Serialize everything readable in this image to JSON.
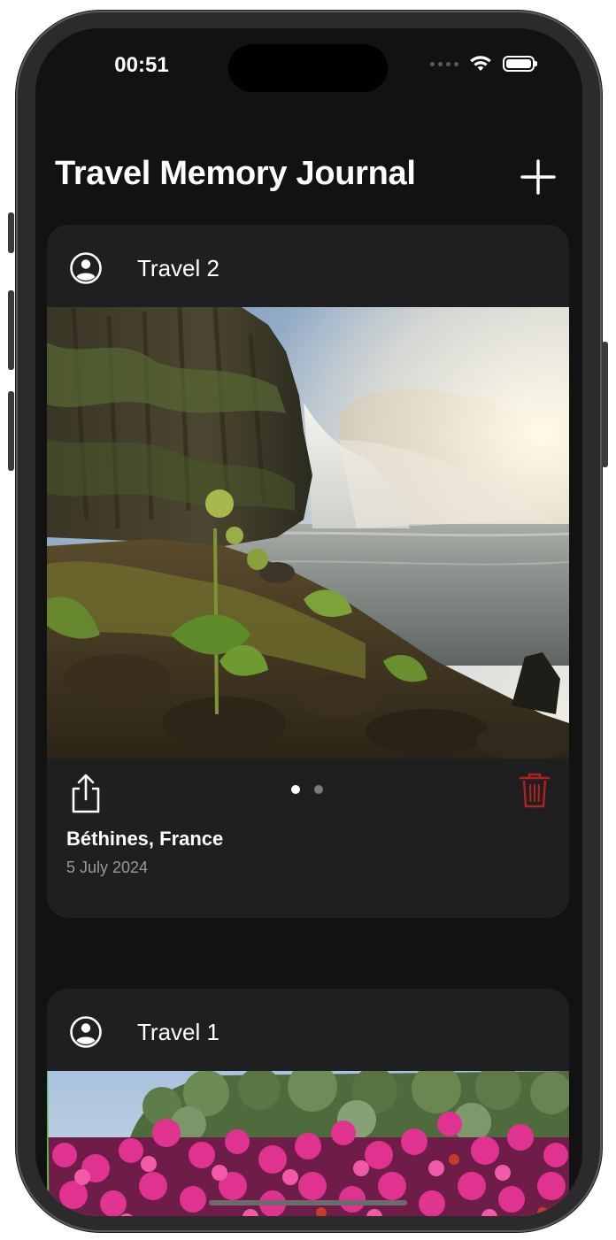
{
  "status_bar": {
    "time": "00:51"
  },
  "header": {
    "title": "Travel Memory Journal",
    "add_icon": "plus-icon"
  },
  "cards": [
    {
      "title": "Travel 2",
      "avatar_icon": "person-circle-icon",
      "photo": "waterfall landscape",
      "location": "Béthines, France",
      "date": "5 July 2024",
      "share_icon": "share-icon",
      "delete_icon": "trash-icon",
      "photo_pages": 2,
      "current_page": 1
    },
    {
      "title": "Travel 1",
      "avatar_icon": "person-circle-icon",
      "photo": "pink flowers garden"
    }
  ],
  "colors": {
    "background": "#121212",
    "card": "#1f1f21",
    "text_primary": "#ffffff",
    "text_secondary": "#9a9a9e",
    "delete": "#b3201f"
  }
}
